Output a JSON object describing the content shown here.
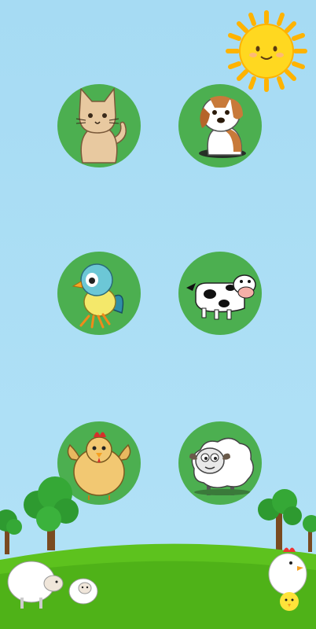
{
  "screen": "animal-sounds-menu",
  "colors": {
    "sky": "#a8dcf4",
    "button": "#4caf50",
    "grass": "#5dc21e",
    "sun": "#ffd820"
  },
  "animals": [
    {
      "id": "cat",
      "icon": "cat-icon"
    },
    {
      "id": "dog",
      "icon": "dog-icon"
    },
    {
      "id": "bird",
      "icon": "bird-icon"
    },
    {
      "id": "cow",
      "icon": "cow-icon"
    },
    {
      "id": "hen",
      "icon": "hen-icon"
    },
    {
      "id": "sheep",
      "icon": "sheep-icon"
    }
  ],
  "decorations": [
    "sun-icon",
    "tree-icon",
    "grass-hill",
    "sheep-decoration",
    "chicken-decoration"
  ]
}
